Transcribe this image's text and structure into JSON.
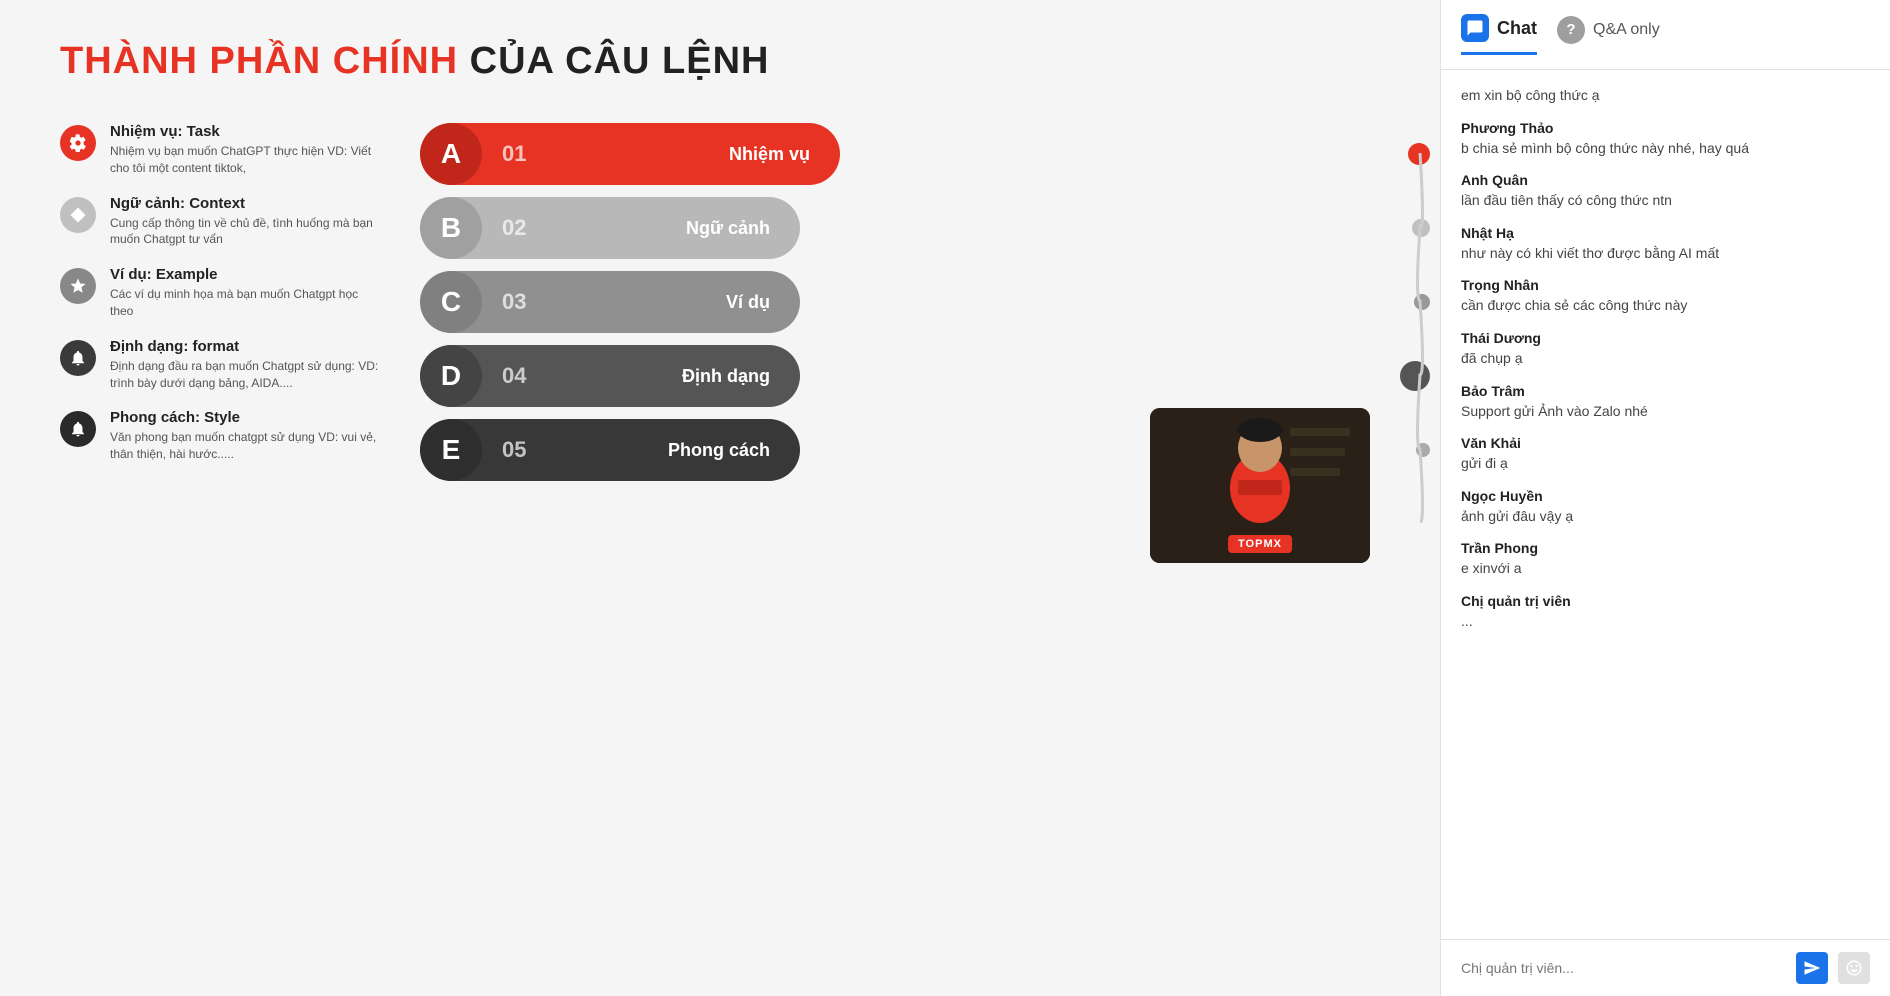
{
  "page": {
    "title": "THÀNH PHẦN CHÍNH CỦA CÂU LỆNH",
    "title_highlight": "THÀNH PHẦN CHÍNH",
    "title_normal": " CỦA CÂU LỆNH"
  },
  "items": [
    {
      "icon": "gear",
      "icon_color": "red",
      "title": "Nhiệm vụ: Task",
      "desc": "Nhiệm vụ bạn muốn ChatGPT thực hiện\nVD: Viết cho tôi một content tiktok,"
    },
    {
      "icon": "diamond",
      "icon_color": "gray1",
      "title": "Ngữ cảnh: Context",
      "desc": "Cung cấp thông tin về chủ đề, tình huống mà\nbạn muốn Chatgpt tư vấn"
    },
    {
      "icon": "star",
      "icon_color": "gray2",
      "title": "Ví dụ: Example",
      "desc": "Các ví dụ minh họa mà bạn muốn Chatgpt\nhọc theo"
    },
    {
      "icon": "bell",
      "icon_color": "dark1",
      "title": "Định dạng: format",
      "desc": "Định dạng đầu ra bạn muốn Chatgpt sử dụng:\nVD: trình bày dưới dạng bảng, AIDA...."
    },
    {
      "icon": "bell2",
      "icon_color": "dark2",
      "title": "Phong cách: Style",
      "desc": "Văn phong bạn muốn chatgpt sử dụng\nVD: vui vẻ, thân thiện, hài hước....."
    }
  ],
  "bars": [
    {
      "letter": "A",
      "number": "01",
      "label": "Nhiệm vụ",
      "color_bar": "#e63324",
      "color_letter": "#c0271a"
    },
    {
      "letter": "B",
      "number": "02",
      "label": "Ngữ cảnh",
      "color_bar": "#b8b8b8",
      "color_letter": "#a0a0a0"
    },
    {
      "letter": "C",
      "number": "03",
      "label": "Ví dụ",
      "color_bar": "#909090",
      "color_letter": "#808080"
    },
    {
      "letter": "D",
      "number": "04",
      "label": "Định dạng",
      "color_bar": "#555555",
      "color_letter": "#444444"
    },
    {
      "letter": "E",
      "number": "05",
      "label": "Phong cách",
      "color_bar": "#383838",
      "color_letter": "#2e2e2e"
    }
  ],
  "dots": [
    {
      "size": 22,
      "color": "#e63324"
    },
    {
      "size": 18,
      "color": "#c0c0c0"
    },
    {
      "size": 16,
      "color": "#999"
    },
    {
      "size": 30,
      "color": "#555"
    },
    {
      "size": 14,
      "color": "#aaa"
    }
  ],
  "video": {
    "logo": "TOPMX"
  },
  "chat": {
    "tab_chat": "Chat",
    "tab_qa": "Q&A only",
    "messages": [
      {
        "sender": "",
        "text": "em xin bộ công thức ạ"
      },
      {
        "sender": "Phương Thảo",
        "text": "b chia sẻ mình bộ công thức này nhé, hay quá"
      },
      {
        "sender": "Anh Quân",
        "text": "lần đầu tiên thấy có công thức ntn"
      },
      {
        "sender": "Nhật Hạ",
        "text": "như này có khi viết thơ được bằng AI mất"
      },
      {
        "sender": "Trọng Nhân",
        "text": "cần được chia sẻ các công thức này"
      },
      {
        "sender": "Thái Dương",
        "text": "đã chụp ạ"
      },
      {
        "sender": "Bảo Trâm",
        "text": "Support gửi Ảnh vào Zalo nhé"
      },
      {
        "sender": "Văn Khải",
        "text": "gửi đi ạ"
      },
      {
        "sender": "Ngọc Huyền",
        "text": "ảnh gửi đâu vậy ạ"
      },
      {
        "sender": "Trần Phong",
        "text": "e xinvới a"
      },
      {
        "sender": "Chị quản trị viên",
        "text": "..."
      }
    ],
    "footer_placeholder": "Chị quản trị viên..."
  }
}
